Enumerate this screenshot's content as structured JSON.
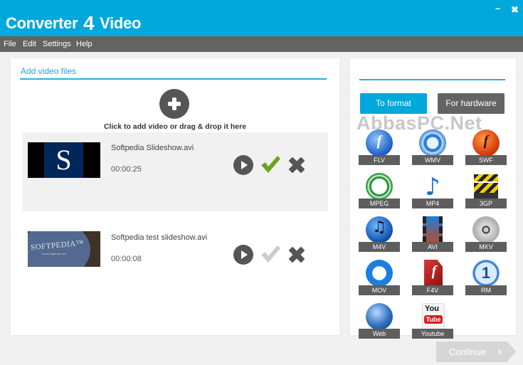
{
  "window": {
    "title_prefix": "Converter",
    "title_number": "4",
    "title_suffix": "Video",
    "minimize_glyph": "–",
    "close_glyph": "✖"
  },
  "menu": {
    "items": [
      {
        "label": "File"
      },
      {
        "label": "Edit"
      },
      {
        "label": "Settings"
      },
      {
        "label": "Help"
      }
    ]
  },
  "left_panel": {
    "title": "Add video files",
    "add_hint": "Click to add video or drag & drop it here",
    "videos": [
      {
        "name": "Softpedia Slideshow.avi",
        "duration": "00:00:25",
        "checked": true,
        "thumb_text": "S"
      },
      {
        "name": "Softpedia test slideshow.avi",
        "duration": "00:00:08",
        "checked": false,
        "thumb_text": "SOFTPEDIA™",
        "thumb_subtext": "www.softpedia.com"
      }
    ]
  },
  "right_panel": {
    "tabs": [
      {
        "label": "To format",
        "active": true
      },
      {
        "label": "For hardware",
        "active": false
      }
    ],
    "watermark": "AbbasPC.Net",
    "formats": [
      {
        "label": "FLV",
        "icon": "flash-icon"
      },
      {
        "label": "WMV",
        "icon": "windows-media-icon"
      },
      {
        "label": "SWF",
        "icon": "flash-red-icon"
      },
      {
        "label": "MPEG",
        "icon": "mpeg-play-icon"
      },
      {
        "label": "MP4",
        "icon": "music-note-icon"
      },
      {
        "label": "3GP",
        "icon": "clapperboard-icon"
      },
      {
        "label": "M4V",
        "icon": "itunes-icon"
      },
      {
        "label": "AVI",
        "icon": "film-strip-icon"
      },
      {
        "label": "MKV",
        "icon": "film-reel-icon"
      },
      {
        "label": "MOV",
        "icon": "quicktime-icon"
      },
      {
        "label": "F4V",
        "icon": "flash-document-icon"
      },
      {
        "label": "RM",
        "icon": "realmedia-icon"
      },
      {
        "label": "Web",
        "icon": "globe-icon"
      },
      {
        "label": "Youtube",
        "icon": "youtube-icon"
      }
    ]
  },
  "footer": {
    "continue_label": "Continue",
    "continue_enabled": false
  },
  "colors": {
    "accent": "#00a8dc",
    "menubar": "#636363",
    "check_active": "#6aa51b",
    "check_inactive": "#cccccc",
    "icon_dark": "#555555"
  }
}
